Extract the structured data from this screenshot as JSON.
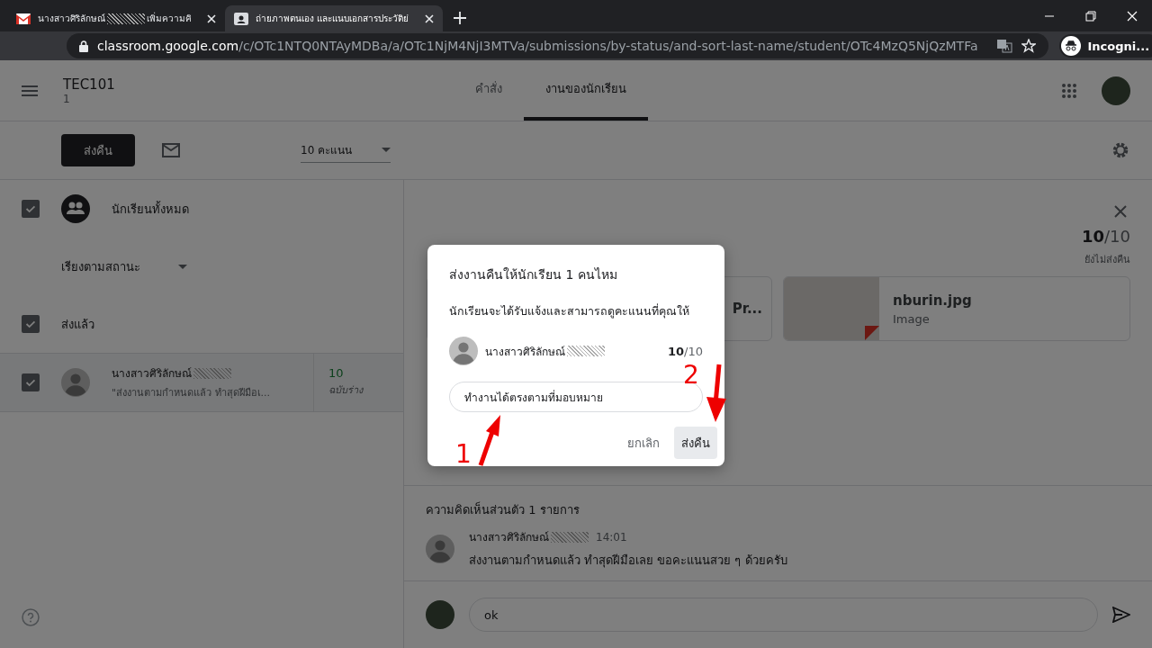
{
  "browser": {
    "tabs": [
      {
        "kind": "mail",
        "title": "นางสาวศิริลักษณ์",
        "redacted": true,
        "title_end": "เพิ่มความคิ",
        "selected": false
      },
      {
        "kind": "classroom",
        "title": "ถ่ายภาพตนเอง และแนบเอกสารประวัติย่",
        "redacted": false,
        "selected": true
      }
    ],
    "url_host": "classroom.google.com",
    "url_path": "/c/OTc1NTQ0NTAyMDBa/a/OTc1NjM4NjI3MTVa/submissions/by-status/and-sort-last-name/student/OTc4MzQ5NjQzMTFa",
    "profile": "Incogni..."
  },
  "header": {
    "class_name": "TEC101",
    "section": "1",
    "tabs": [
      {
        "label": "คำสั่ง",
        "selected": false
      },
      {
        "label": "งานของนักเรียน",
        "selected": true
      }
    ]
  },
  "toolbar": {
    "return_button": "ส่งคืน",
    "points": "10 คะแนน"
  },
  "student_list": {
    "all_students": {
      "label": "นักเรียนทั้งหมด",
      "checked": true
    },
    "sort": "เรียงตามสถานะ",
    "group": {
      "label": "ส่งแล้ว",
      "checked": true
    },
    "students": [
      {
        "name": "นางสาวศิริลักษณ์",
        "redacted": true,
        "preview": "\"ส่งงานตามกำหนดแล้ว ทำสุดฝีมือเ...",
        "grade": "10",
        "status": "ฉบับร่าง",
        "checked": true
      }
    ]
  },
  "submission": {
    "score": "10",
    "max": "/10",
    "status": "ยังไม่ส่งคืน",
    "files": [
      {
        "kind": "doc",
        "name": "Pr..."
      },
      {
        "kind": "image",
        "name": "nburin.jpg",
        "type": "Image"
      }
    ],
    "comments_title": "ความคิดเห็นส่วนตัว 1 รายการ",
    "comments": [
      {
        "author": "นางสาวศิริลักษณ์",
        "redacted": true,
        "time": "14:01",
        "text": "ส่งงานตามกำหนดแล้ว ทำสุดฝีมือเลย ขอคะแนนสวย ๆ ด้วยครับ"
      }
    ],
    "reply": "ok"
  },
  "dialog": {
    "title": "ส่งงานคืนให้นักเรียน 1 คนไหม",
    "message": "นักเรียนจะได้รับแจ้งและสามารถดูคะแนนที่คุณให้",
    "student": {
      "name": "นางสาวศิริลักษณ์",
      "redacted": true,
      "score": "10",
      "max": "/10"
    },
    "comment": "ทำงานได้ตรงตามที่มอบหมาย",
    "buttons": [
      {
        "label": "ยกเลิก",
        "kind": "text"
      },
      {
        "label": "ส่งคืน",
        "kind": "primary"
      }
    ]
  },
  "annotations": [
    {
      "label": "1",
      "kind": "up"
    },
    {
      "label": "2",
      "kind": "down"
    }
  ]
}
